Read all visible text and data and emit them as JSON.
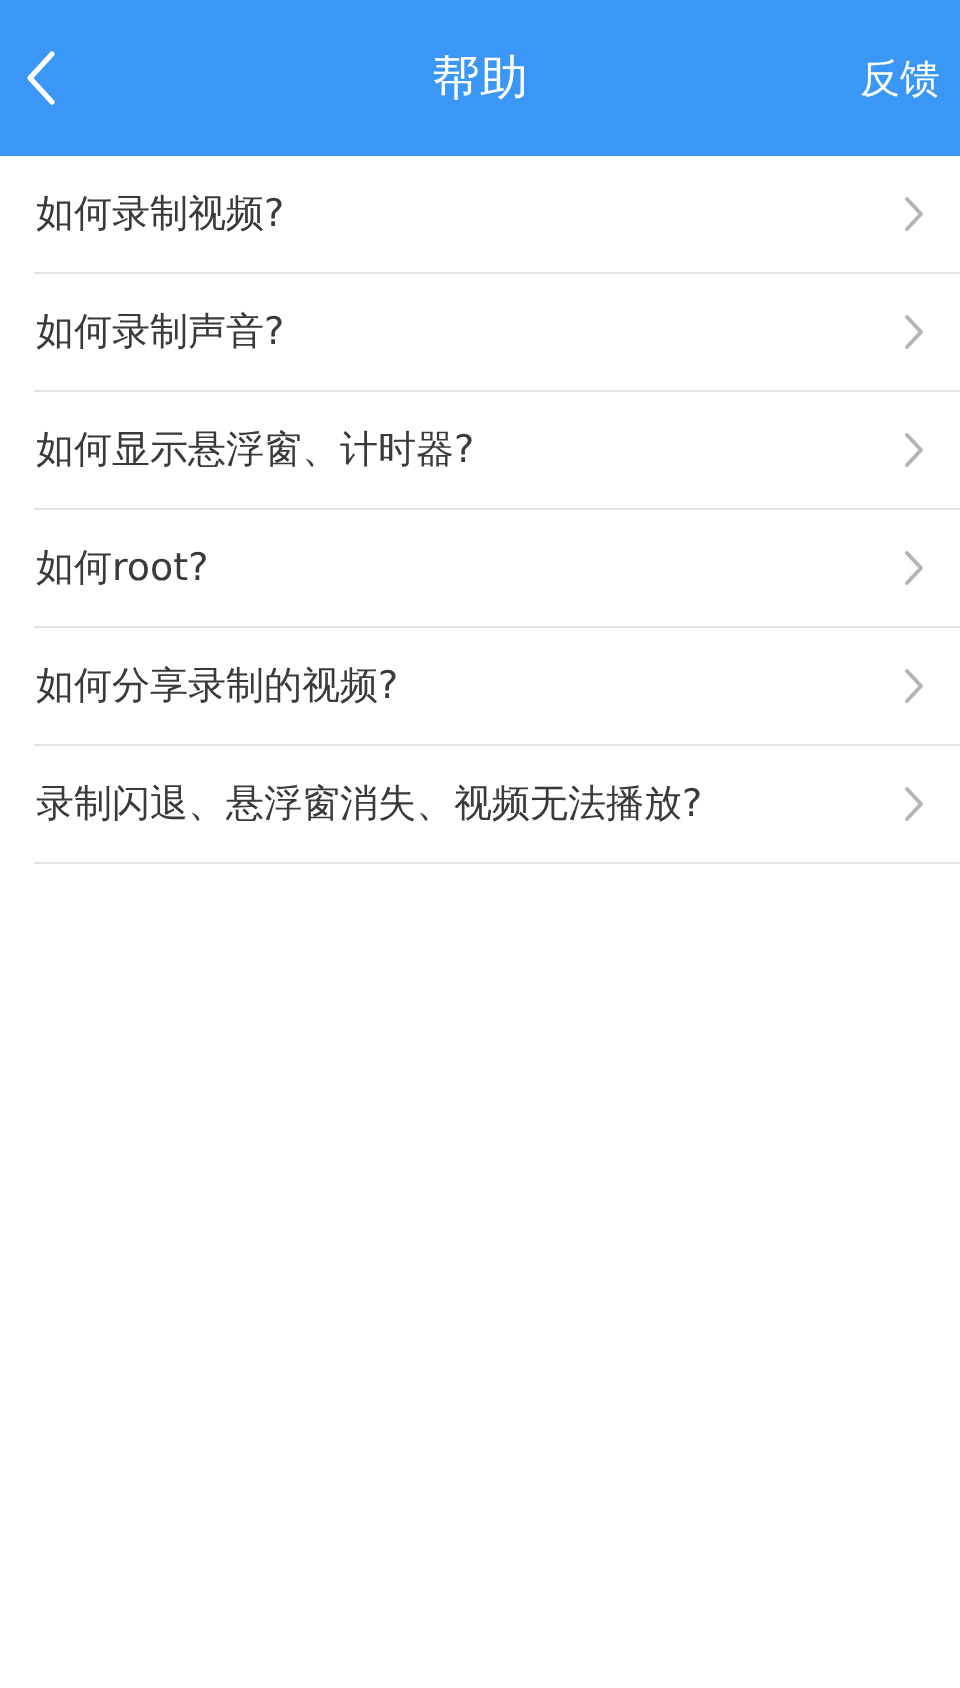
{
  "header": {
    "title": "帮助",
    "action": "反馈"
  },
  "items": [
    {
      "label": "如何录制视频?"
    },
    {
      "label": "如何录制声音?"
    },
    {
      "label": "如何显示悬浮窗、计时器?"
    },
    {
      "label": "如何root?"
    },
    {
      "label": "如何分享录制的视频?"
    },
    {
      "label": "录制闪退、悬浮窗消失、视频无法播放?"
    }
  ]
}
